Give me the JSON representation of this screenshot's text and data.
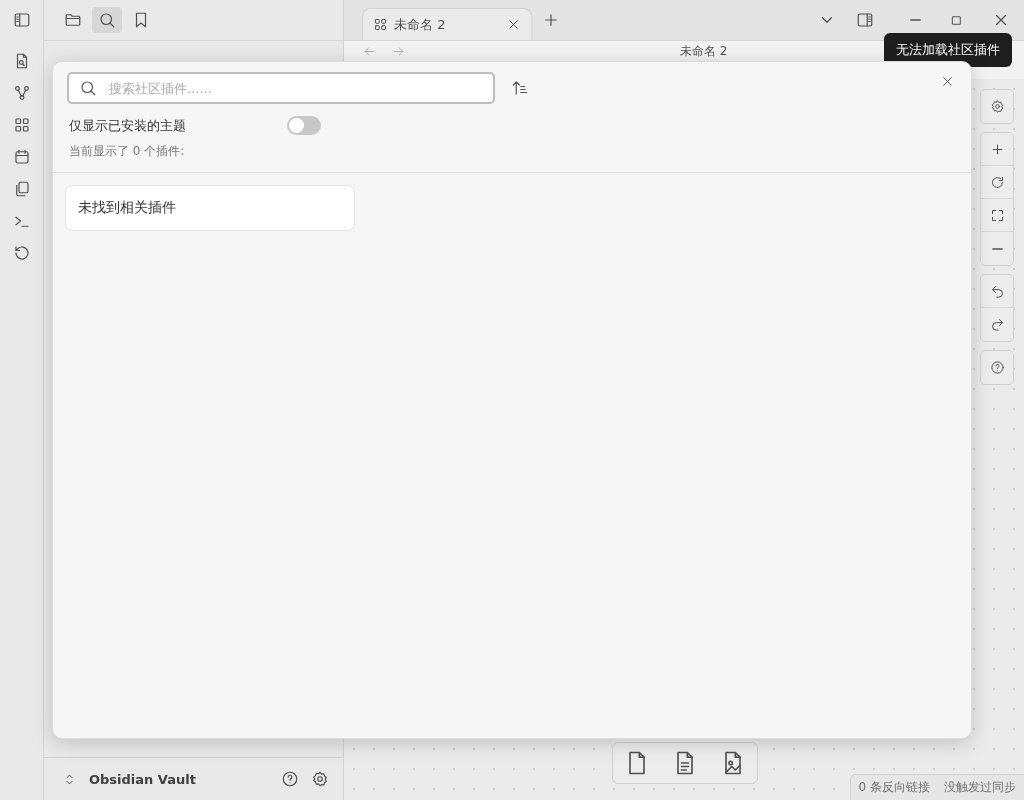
{
  "tabs": [
    {
      "title": "未命名 2",
      "selected": true
    }
  ],
  "view_title": "未命名 2",
  "tooltip": "无法加载社区插件",
  "sidebar": {
    "vault_name": "Obsidian Vault"
  },
  "modal": {
    "search": {
      "placeholder": "搜索社区插件......"
    },
    "toggle": {
      "label": "仅显示已安装的主题",
      "on": false
    },
    "count_text": "当前显示了 0 个插件:",
    "empty_message": "未找到相关插件"
  },
  "status_bar": [
    "0 条反向链接",
    "没触发过同步"
  ]
}
